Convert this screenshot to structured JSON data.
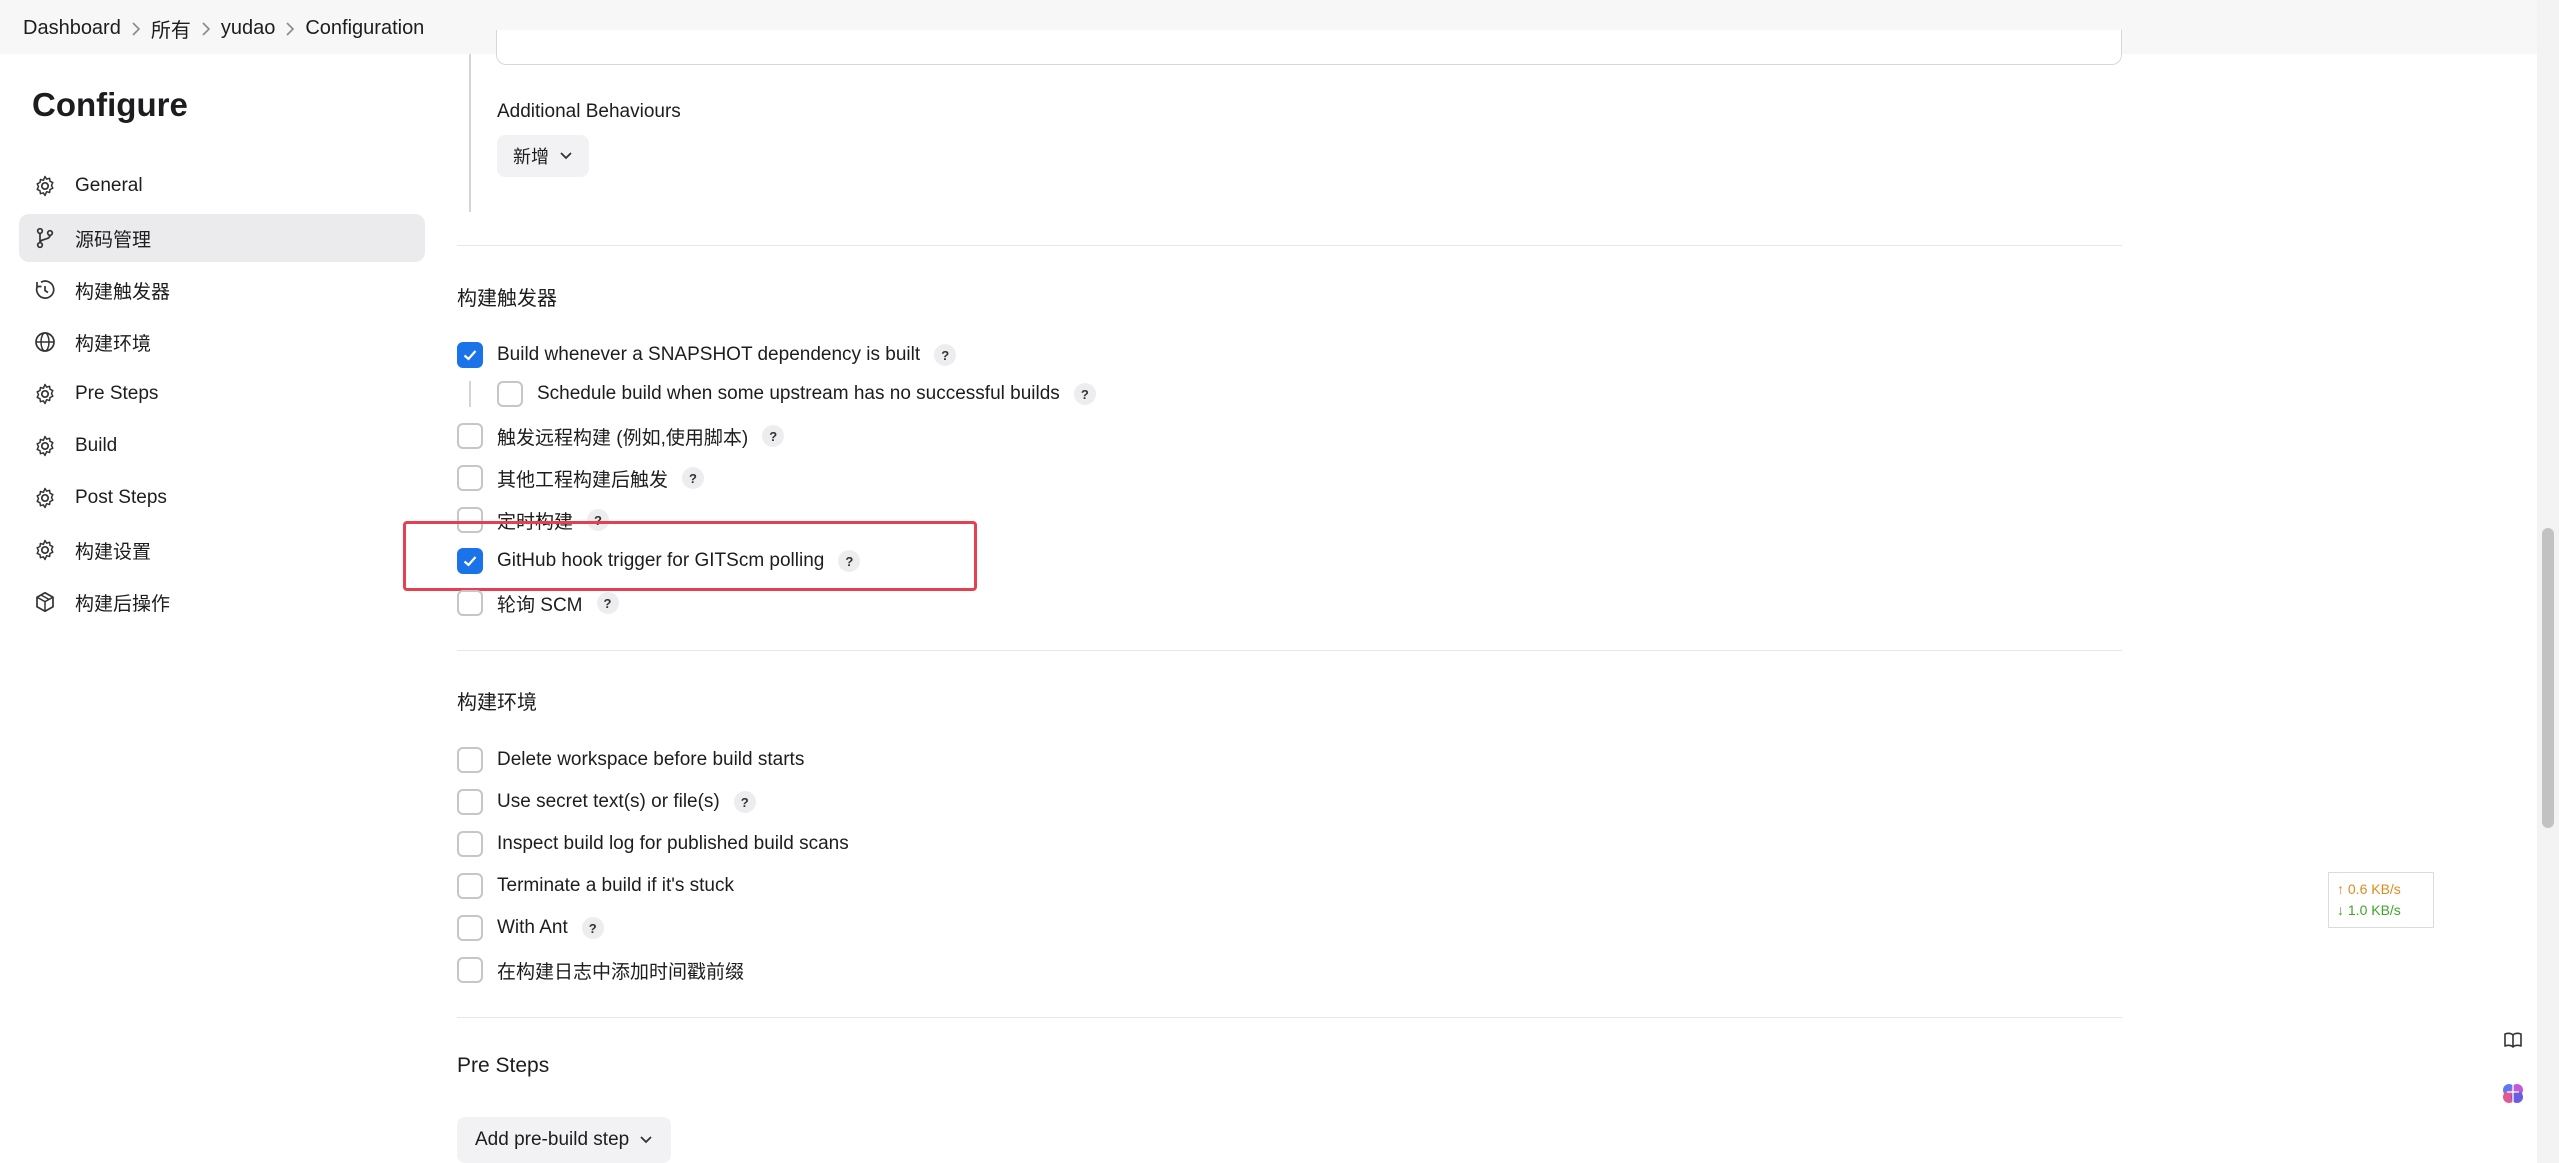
{
  "breadcrumb": [
    "Dashboard",
    "所有",
    "yudao",
    "Configuration"
  ],
  "sidebar": {
    "title": "Configure",
    "items": [
      {
        "label": "General",
        "icon": "gear-icon",
        "active": false
      },
      {
        "label": "源码管理",
        "icon": "branch-icon",
        "active": true
      },
      {
        "label": "构建触发器",
        "icon": "clock-icon",
        "active": false
      },
      {
        "label": "构建环境",
        "icon": "globe-icon",
        "active": false
      },
      {
        "label": "Pre Steps",
        "icon": "gear-icon",
        "active": false
      },
      {
        "label": "Build",
        "icon": "gear-icon",
        "active": false
      },
      {
        "label": "Post Steps",
        "icon": "gear-icon",
        "active": false
      },
      {
        "label": "构建设置",
        "icon": "gear-icon",
        "active": false
      },
      {
        "label": "构建后操作",
        "icon": "cube-icon",
        "active": false
      }
    ]
  },
  "scm": {
    "additional_behaviours_label": "Additional Behaviours",
    "add_button": "新增"
  },
  "triggers": {
    "title": "构建触发器",
    "items": [
      {
        "label": "Build whenever a SNAPSHOT dependency is built",
        "checked": true,
        "help": "?"
      },
      {
        "label": "Schedule build when some upstream has no successful builds",
        "checked": false,
        "help": "?"
      },
      {
        "label": "触发远程构建 (例如,使用脚本)",
        "checked": false,
        "help": "?"
      },
      {
        "label": "其他工程构建后触发",
        "checked": false,
        "help": "?"
      },
      {
        "label": "定时构建",
        "checked": false,
        "help": "?"
      },
      {
        "label": "GitHub hook trigger for GITScm polling",
        "checked": true,
        "help": "?"
      },
      {
        "label": "轮询 SCM",
        "checked": false,
        "help": "?"
      }
    ]
  },
  "environment": {
    "title": "构建环境",
    "items": [
      {
        "label": "Delete workspace before build starts",
        "checked": false
      },
      {
        "label": "Use secret text(s) or file(s)",
        "checked": false,
        "help": "?"
      },
      {
        "label": "Inspect build log for published build scans",
        "checked": false
      },
      {
        "label": "Terminate a build if it's stuck",
        "checked": false
      },
      {
        "label": "With Ant",
        "checked": false,
        "help": "?"
      },
      {
        "label": "在构建日志中添加时间戳前缀",
        "checked": false
      }
    ]
  },
  "pre_steps": {
    "title": "Pre Steps",
    "add_button": "Add pre-build step"
  },
  "net_speed": {
    "up": "↑ 0.6 KB/s",
    "down": "↓ 1.0 KB/s"
  },
  "colors": {
    "accent": "#1a73e8",
    "highlight": "#e5404f",
    "active_bg": "#ebebee"
  }
}
